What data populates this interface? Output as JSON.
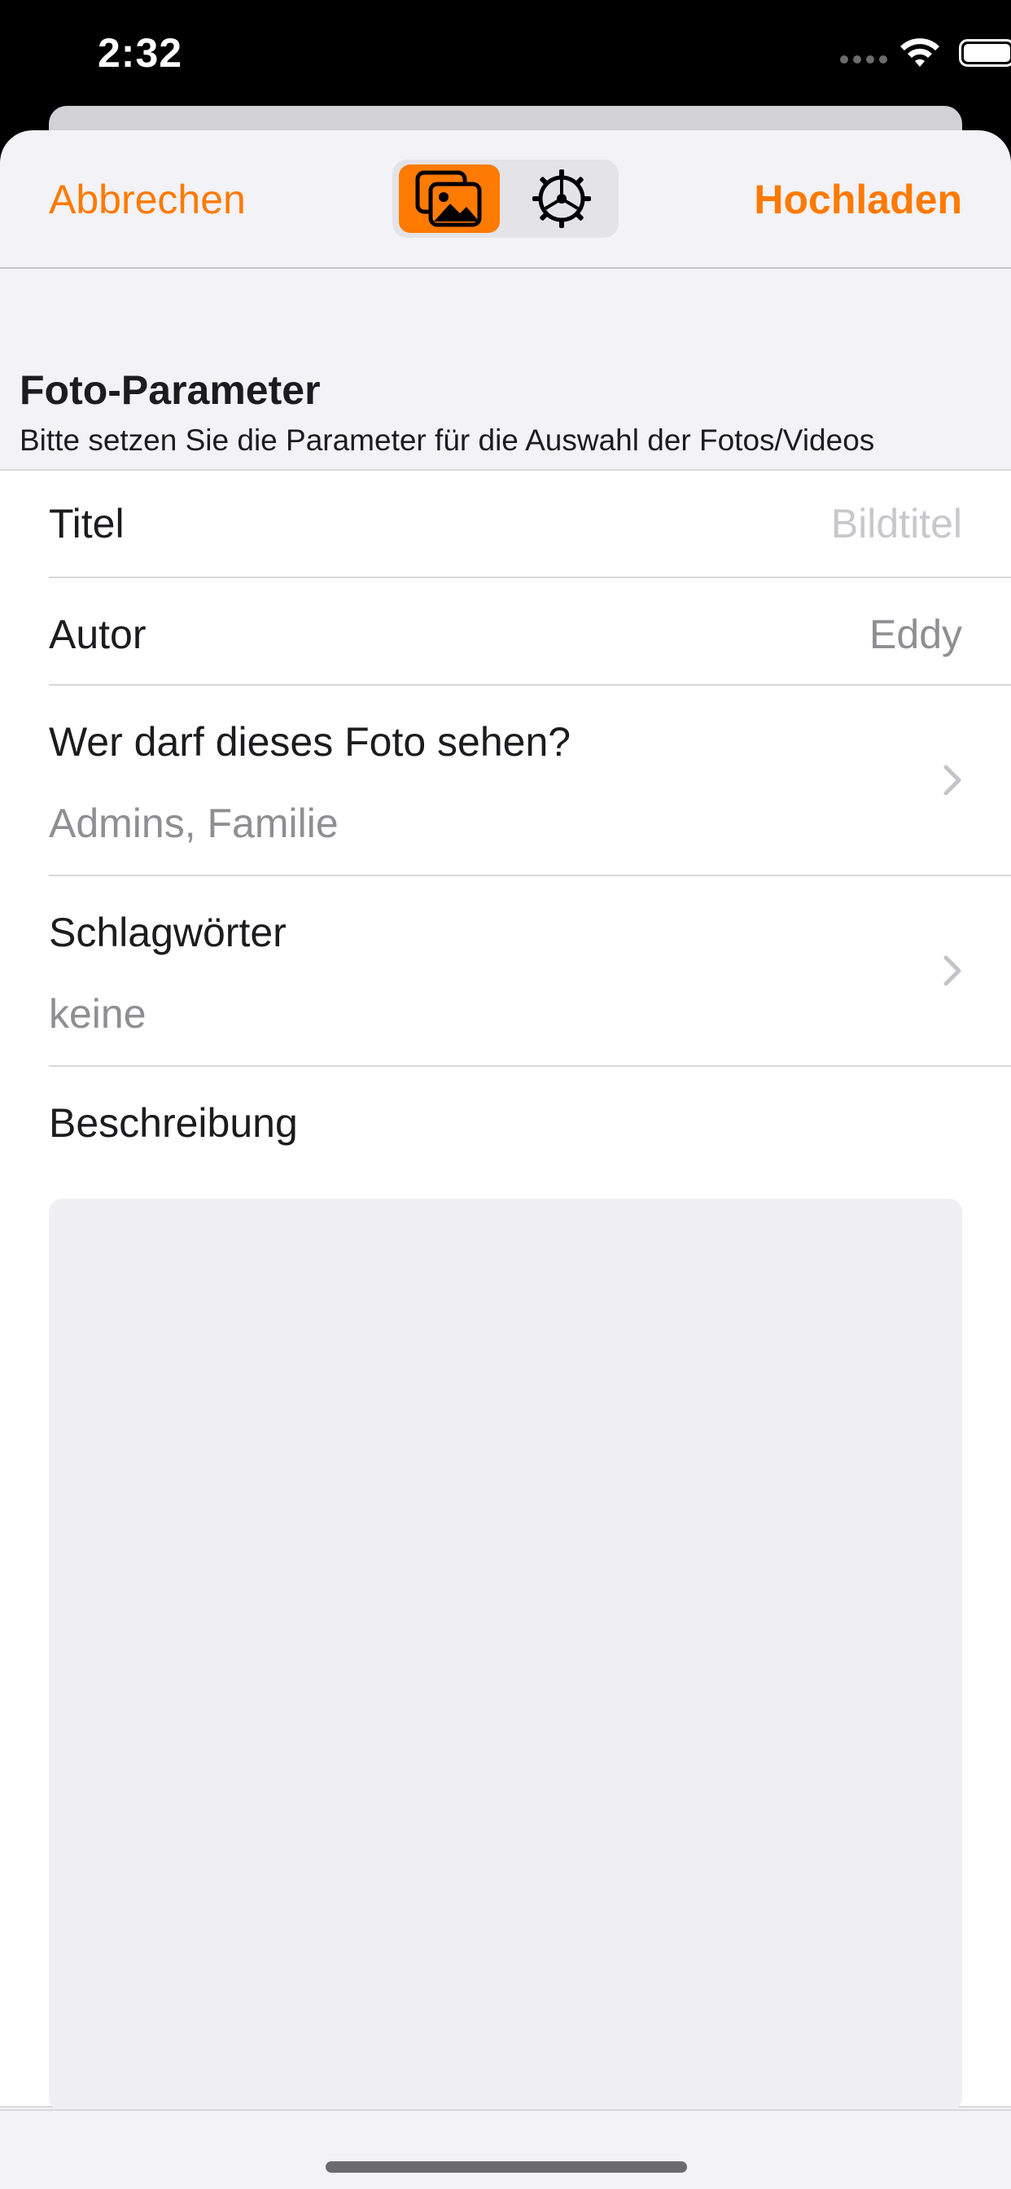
{
  "status_bar": {
    "time": "2:32",
    "icons": [
      "cellular-icon",
      "wifi-icon",
      "battery-icon"
    ]
  },
  "nav": {
    "cancel_label": "Abbrechen",
    "upload_label": "Hochladen",
    "segments": [
      {
        "icon": "photos-icon",
        "selected": true
      },
      {
        "icon": "gear-icon",
        "selected": false
      }
    ],
    "accent_color": "#ff7a00"
  },
  "section": {
    "title": "Foto-Parameter",
    "subtitle": "Bitte setzen Sie die Parameter für die Auswahl der Fotos/Videos"
  },
  "form": {
    "title_row": {
      "label": "Titel",
      "placeholder": "Bildtitel"
    },
    "author_row": {
      "label": "Autor",
      "value": "Eddy"
    },
    "privacy_row": {
      "label": "Wer darf dieses Foto sehen?",
      "value": "Admins, Familie"
    },
    "tags_row": {
      "label": "Schlagwörter",
      "value": "keine"
    },
    "description": {
      "label": "Beschreibung",
      "value": ""
    }
  }
}
